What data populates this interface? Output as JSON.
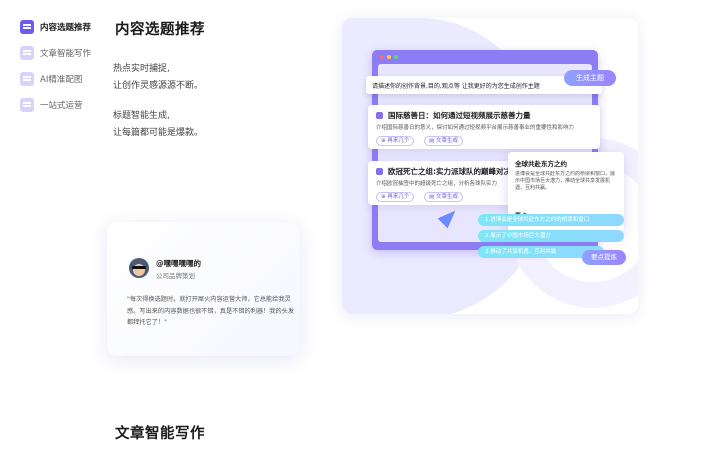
{
  "sidebar": {
    "items": [
      {
        "label": "内容选题推荐",
        "active": true
      },
      {
        "label": "文章智能写作",
        "active": false
      },
      {
        "label": "AI精准配图",
        "active": false
      },
      {
        "label": "一站式运营",
        "active": false
      }
    ]
  },
  "section1": {
    "title": "内容选题推荐",
    "desc1_line1": "热点实时捕捉,",
    "desc1_line2": "让创作灵感源源不断。",
    "desc2_line1": "标题智能生成,",
    "desc2_line2": "让每篇都可能是爆款。"
  },
  "testimonial": {
    "name": "@嘿嘿嘿嘿的",
    "role": "公司品牌策划",
    "quote": "\"每次得换选题时，就打开犀火内容运营大师，它总能给我灵感。写出来的内容数据也很不错，真是不错的利器！我的头发都拜托它了！\""
  },
  "demo": {
    "prompt": "请描述你的创作背景,目的,观点等 让我更好的为您生成创作主题",
    "generate_button": "生成主题",
    "results": [
      {
        "title": "国际慈善日：如何通过短视频展示慈善力量",
        "subtitle": "介绍国际慈善日的意义，探讨如何通过短视频平台展示慈善事业的重要性和影响力",
        "chip1": "再来几个",
        "chip2": "文章生成"
      },
      {
        "title": "欧冠死亡之组:实力派球队的巅峰对决",
        "subtitle": "介绍欧冠抽签中的超级死亡之组，分析各球队实力",
        "chip1": "再来几个",
        "chip2": "文章生成"
      }
    ],
    "summary": {
      "title": "全球共赴东方之约",
      "body": "进博会是全球共赴东方之约的桥梁和窗口，展示中国市场巨大潜力，推动全球共享发展机遇，互利共赢。",
      "key_label": "要点"
    },
    "key_points": [
      "1.进博会是全球共赴东方之约的桥梁和窗口",
      "2.展示了中国市场巨大潜力",
      "3.推动了共享机遇，互利共赢"
    ],
    "key_button": "要点提炼"
  },
  "section2": {
    "title": "文章智能写作"
  }
}
